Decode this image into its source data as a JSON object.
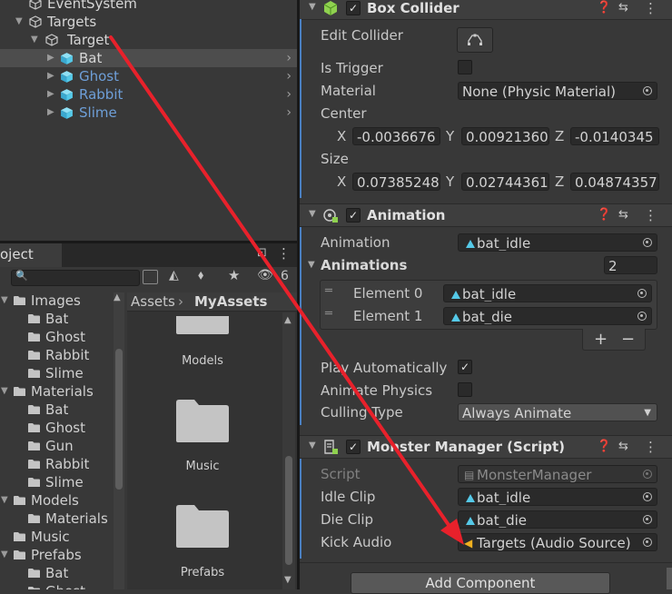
{
  "hierarchy": {
    "items": [
      {
        "label": "EventSystem"
      },
      {
        "label": "Targets"
      },
      {
        "label": "Target"
      },
      {
        "label": "Bat"
      },
      {
        "label": "Ghost"
      },
      {
        "label": "Rabbit"
      },
      {
        "label": "Slime"
      }
    ]
  },
  "project": {
    "tab_label": "oject",
    "badge": "6",
    "tree": [
      "Images",
      "Bat",
      "Ghost",
      "Rabbit",
      "Slime",
      "Materials",
      "Bat",
      "Ghost",
      "Gun",
      "Rabbit",
      "Slime",
      "Models",
      "Materials",
      "Music",
      "Prefabs",
      "Bat",
      "Ghost"
    ],
    "breadcrumb": [
      "Assets",
      "MyAssets"
    ],
    "assets": [
      "Models",
      "Music",
      "Prefabs"
    ]
  },
  "inspector": {
    "box_collider": {
      "title": "Box Collider",
      "edit_collider": "Edit Collider",
      "is_trigger": "Is Trigger",
      "material_label": "Material",
      "material_value": "None (Physic Material)",
      "center_label": "Center",
      "center": {
        "x": "-0.0036676",
        "y": "0.00921360",
        "z": "-0.0140345"
      },
      "size_label": "Size",
      "size": {
        "x": "0.07385248",
        "y": "0.02744361",
        "z": "0.04874357"
      },
      "axis_x": "X",
      "axis_y": "Y",
      "axis_z": "Z"
    },
    "animation": {
      "title": "Animation",
      "animation_label": "Animation",
      "animation_value": "bat_idle",
      "animations_label": "Animations",
      "count": "2",
      "elements": [
        {
          "label": "Element 0",
          "value": "bat_idle"
        },
        {
          "label": "Element 1",
          "value": "bat_die"
        }
      ],
      "plus": "+",
      "minus": "−",
      "play_auto": "Play Automatically",
      "animate_physics": "Animate Physics",
      "culling_label": "Culling Type",
      "culling_value": "Always Animate"
    },
    "monster": {
      "title": "Monster Manager (Script)",
      "script_label": "Script",
      "script_value": "MonsterManager",
      "idle_label": "Idle Clip",
      "idle_value": "bat_idle",
      "die_label": "Die Clip",
      "die_value": "bat_die",
      "kick_label": "Kick Audio",
      "kick_value": "Targets (Audio Source)"
    },
    "add_component": "Add Component"
  },
  "colors": {
    "accent_blue": "#4a7fc1",
    "arrow_red": "#e8212b",
    "cube_blue": "#55c9e8"
  }
}
